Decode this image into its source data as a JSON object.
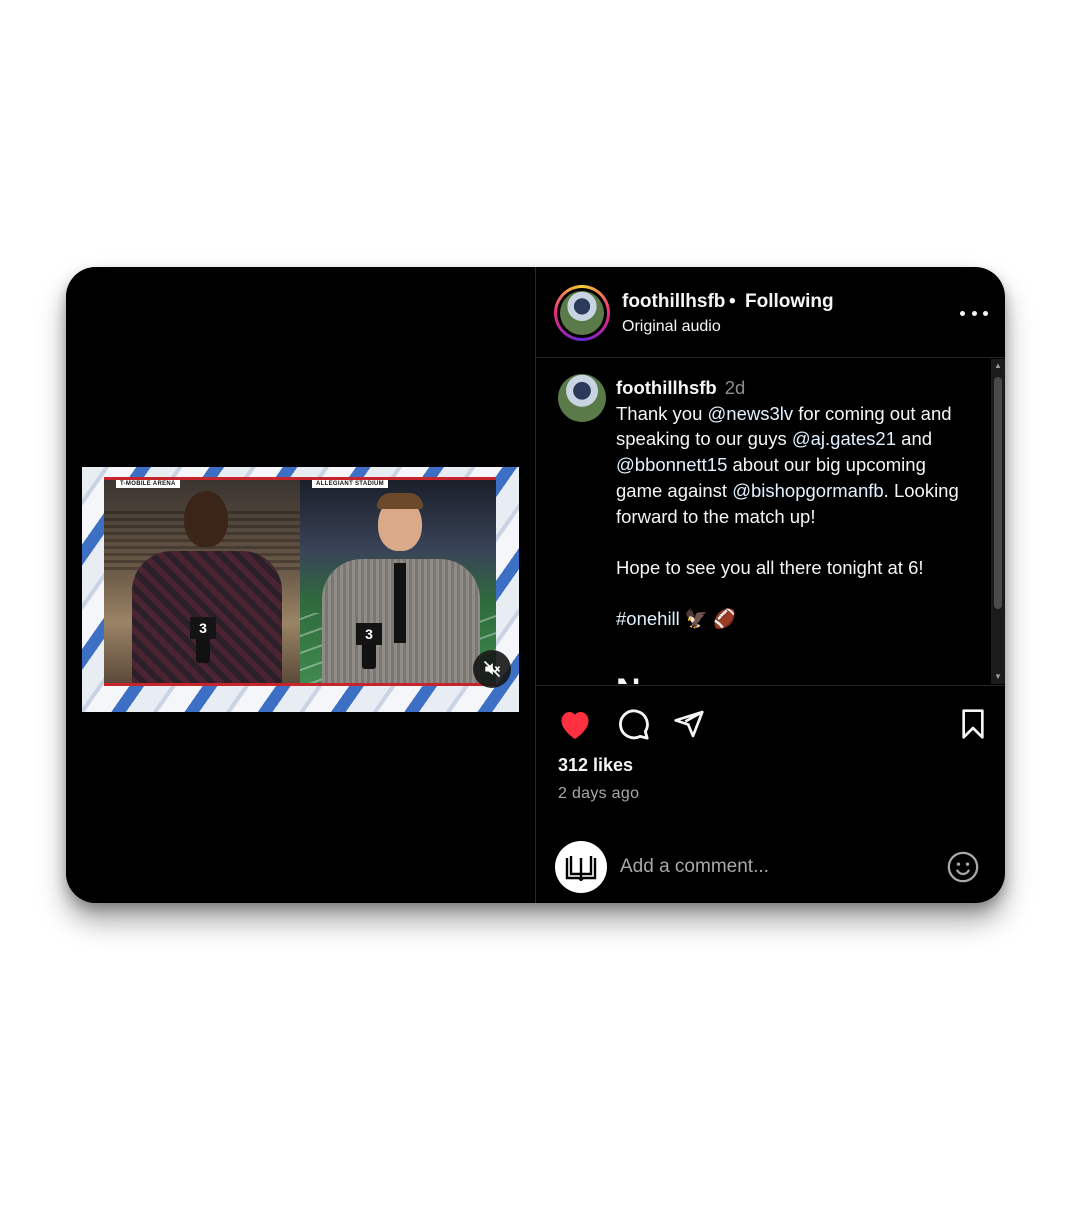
{
  "video": {
    "left_panel_label": "T-MOBILE ARENA",
    "right_panel_label": "ALLEGIANT STADIUM",
    "mic_flag": "3"
  },
  "header": {
    "username": "foothillhsfb",
    "separator": "•",
    "follow_status": "Following",
    "audio": "Original audio"
  },
  "caption": {
    "username": "foothillhsfb",
    "time": "2d",
    "line1_pre": "Thank you ",
    "mention1": "@news3lv",
    "line1_post": " for coming out and speaking to our guys ",
    "mention2": "@aj.gates21",
    "line2_pre": " and ",
    "mention3": "@bbonnett15",
    "line2_post": " about our big upcoming game against ",
    "mention4": "@bishopgormanfb",
    "line3": ". Looking forward to the match up!",
    "paragraph2": "Hope to see you all there tonight at 6!",
    "hashtag": "#onehill",
    "emojis": "🦅 🏈",
    "cut_text": "N"
  },
  "actions": {
    "likes": "312 likes",
    "posted": "2 days ago",
    "liked": true,
    "heart_color": "#ff3040"
  },
  "comment": {
    "placeholder": "Add a comment..."
  },
  "icons": [
    "volume-muted-icon",
    "more-options-icon",
    "heart-icon",
    "comment-icon",
    "share-icon",
    "bookmark-icon",
    "emoji-icon",
    "book-icon"
  ]
}
